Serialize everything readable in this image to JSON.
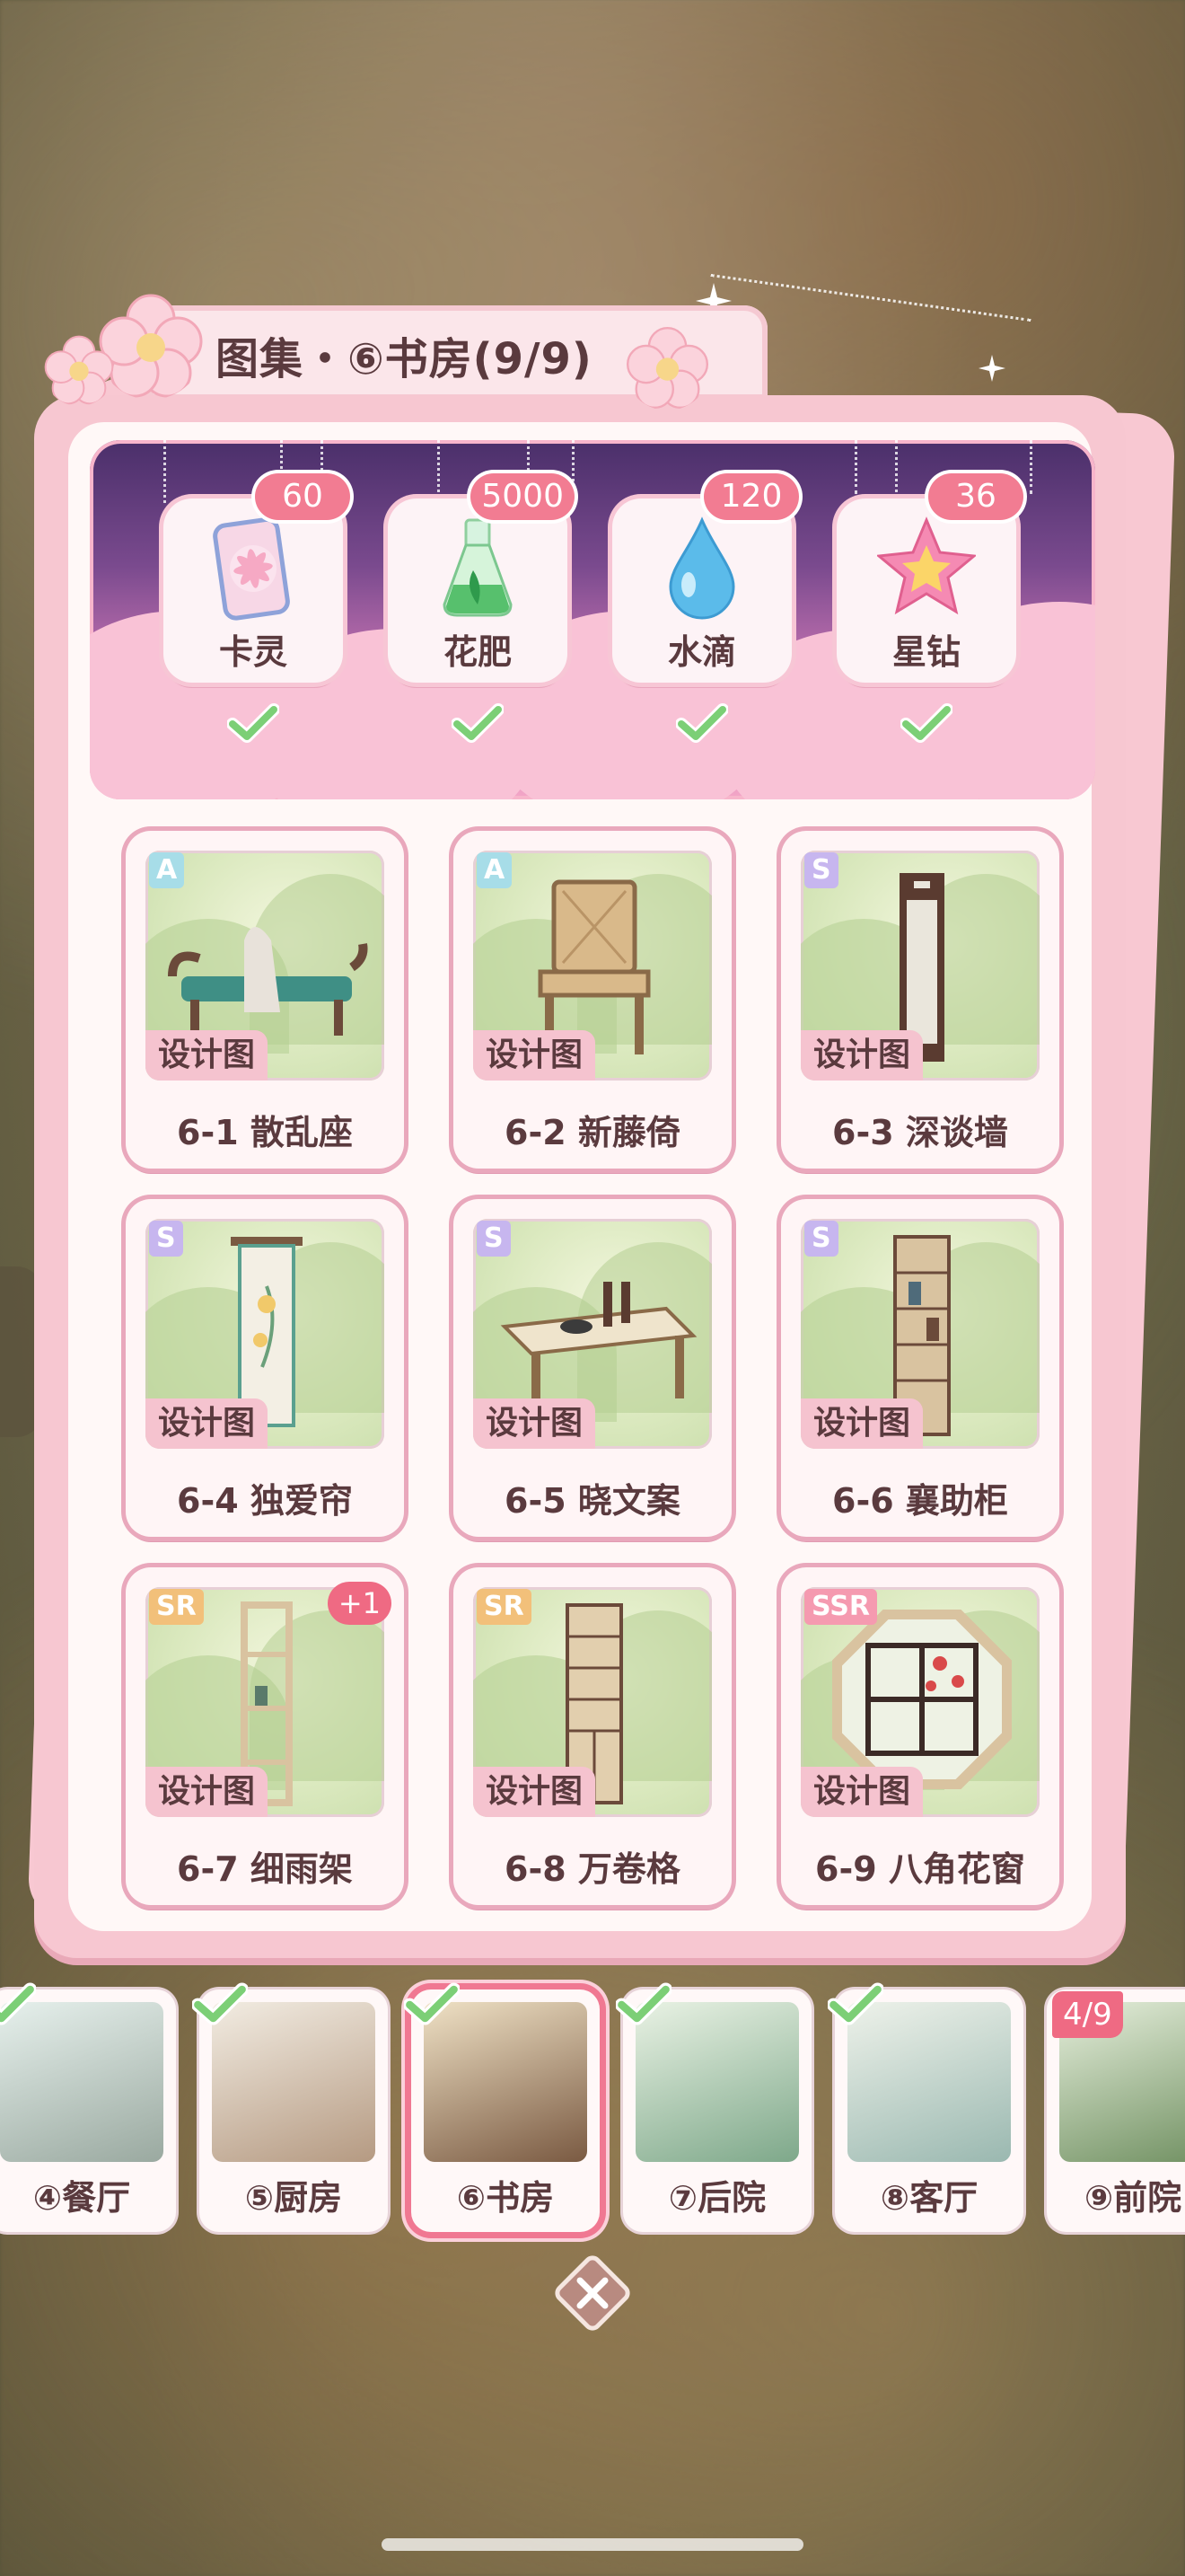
{
  "header": {
    "title": "图集・⑥书房(9/9)"
  },
  "rewards": [
    {
      "label": "卡灵",
      "count": "60",
      "icon": "card-spirit-icon",
      "claimed": true
    },
    {
      "label": "花肥",
      "count": "5000",
      "icon": "fertilizer-flask-icon",
      "claimed": true
    },
    {
      "label": "水滴",
      "count": "120",
      "icon": "water-drop-icon",
      "claimed": true
    },
    {
      "label": "星钻",
      "count": "36",
      "icon": "star-diamond-icon",
      "claimed": true
    }
  ],
  "blueprint_tag": "设计图",
  "items": [
    {
      "name": "6-1 散乱座",
      "rarity": "A"
    },
    {
      "name": "6-2 新藤倚",
      "rarity": "A"
    },
    {
      "name": "6-3 深谈墙",
      "rarity": "S"
    },
    {
      "name": "6-4 独爱帘",
      "rarity": "S"
    },
    {
      "name": "6-5 晓文案",
      "rarity": "S"
    },
    {
      "name": "6-6 襄助柜",
      "rarity": "S"
    },
    {
      "name": "6-7 细雨架",
      "rarity": "SR",
      "badge": "+1"
    },
    {
      "name": "6-8 万卷格",
      "rarity": "SR"
    },
    {
      "name": "6-9 八角花窗",
      "rarity": "SSR"
    }
  ],
  "rooms": [
    {
      "label": "④餐厅",
      "completed": true
    },
    {
      "label": "⑤厨房",
      "completed": true
    },
    {
      "label": "⑥书房",
      "completed": true,
      "active": true
    },
    {
      "label": "⑦后院",
      "completed": true
    },
    {
      "label": "⑧客厅",
      "completed": true
    },
    {
      "label": "⑨前院",
      "progress": "4/9"
    }
  ],
  "colors": {
    "accent": "#f07892",
    "panel": "#f7c7d1",
    "text": "#5a3a3e"
  }
}
